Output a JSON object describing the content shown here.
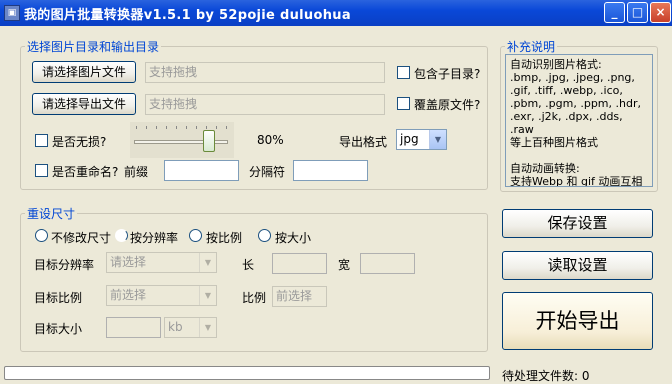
{
  "window": {
    "title": "我的图片批量转换器v1.5.1 by 52pojie duluohua",
    "minimize": "_",
    "maximize": "□",
    "close": "×"
  },
  "group_dir": {
    "legend": "选择图片目录和输出目录",
    "select_image_btn": "请选择图片文件",
    "image_path_placeholder": "支持拖拽",
    "include_subdir": "包含子目录?",
    "select_export_btn": "请选择导出文件",
    "export_path_placeholder": "支持拖拽",
    "overwrite": "覆盖原文件?",
    "lossless": "是否无损?",
    "quality_value": 0.8,
    "quality_label": "80%",
    "export_format_label": "导出格式",
    "export_format_value": "jpg",
    "rename": "是否重命名?",
    "prefix_label": "前缀",
    "separator_label": "分隔符"
  },
  "group_note": {
    "legend": "补充说明",
    "text": "自动识别图片格式:\n.bmp, .jpg, .jpeg, .png,\n.gif, .tiff, .webp, .ico,\n.pbm, .pgm, .ppm, .hdr,\n.exr, .j2k, .dpx, .dds, .raw\n等上百种图片格式\n\n自动动画转换:\n支持Webp 和 gif 动画互相\n转换"
  },
  "group_resize": {
    "legend": "重设尺寸",
    "radio_keep": "不修改尺寸",
    "radio_resolution": "按分辨率",
    "radio_ratio": "按比例",
    "radio_size": "按大小",
    "target_resolution_label": "目标分辨率",
    "target_resolution_placeholder": "请选择",
    "length_label": "长",
    "width_label": "宽",
    "target_ratio_label": "目标比例",
    "target_ratio_placeholder": "前选择",
    "ratio_label": "比例",
    "ratio_placeholder": "前选择",
    "target_size_label": "目标大小",
    "size_unit": "kb"
  },
  "actions": {
    "save": "保存设置",
    "load": "读取设置",
    "start": "开始导出"
  },
  "status": {
    "pending_files": "待处理文件数: 0",
    "progress": 0
  }
}
